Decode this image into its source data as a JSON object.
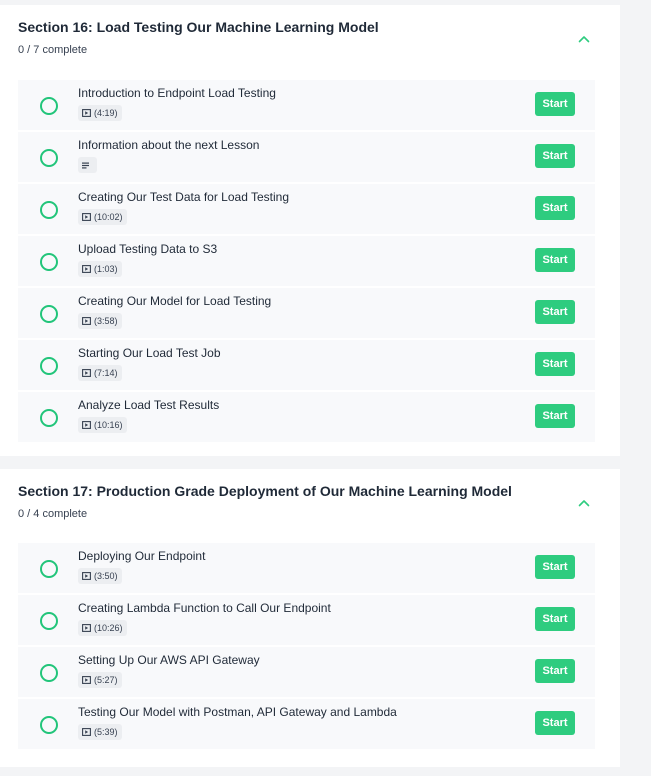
{
  "colors": {
    "accent": "#2ecc7f",
    "circle": "#22c57a",
    "row_bg": "#f8f9fb"
  },
  "sections": [
    {
      "title": "Section 16: Load Testing Our Machine Learning Model",
      "progress": "0 / 7 complete",
      "toggle_icon": "chevron-up-icon",
      "lessons": [
        {
          "title": "Introduction to Endpoint Load Testing",
          "type": "video",
          "duration": "(4:19)",
          "button": "Start"
        },
        {
          "title": "Information about the next Lesson",
          "type": "text",
          "duration": "",
          "button": "Start"
        },
        {
          "title": "Creating Our Test Data for Load Testing",
          "type": "video",
          "duration": "(10:02)",
          "button": "Start"
        },
        {
          "title": "Upload Testing Data to S3",
          "type": "video",
          "duration": "(1:03)",
          "button": "Start"
        },
        {
          "title": "Creating Our Model for Load Testing",
          "type": "video",
          "duration": "(3:58)",
          "button": "Start"
        },
        {
          "title": "Starting Our Load Test Job",
          "type": "video",
          "duration": "(7:14)",
          "button": "Start"
        },
        {
          "title": "Analyze Load Test Results",
          "type": "video",
          "duration": "(10:16)",
          "button": "Start"
        }
      ]
    },
    {
      "title": "Section 17: Production Grade Deployment of Our Machine Learning Model",
      "progress": "0 / 4 complete",
      "toggle_icon": "chevron-up-icon",
      "lessons": [
        {
          "title": "Deploying Our Endpoint",
          "type": "video",
          "duration": "(3:50)",
          "button": "Start"
        },
        {
          "title": "Creating Lambda Function to Call Our Endpoint",
          "type": "video",
          "duration": "(10:26)",
          "button": "Start"
        },
        {
          "title": "Setting Up Our AWS API Gateway",
          "type": "video",
          "duration": "(5:27)",
          "button": "Start"
        },
        {
          "title": "Testing Our Model with Postman, API Gateway and Lambda",
          "type": "video",
          "duration": "(5:39)",
          "button": "Start"
        }
      ]
    }
  ]
}
